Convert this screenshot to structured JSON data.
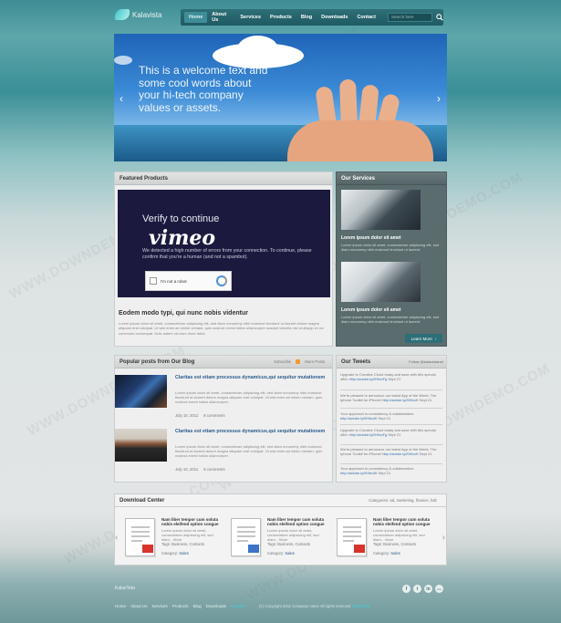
{
  "header": {
    "logo_text": "Kalavista",
    "nav": [
      {
        "label": "Home",
        "active": true
      },
      {
        "label": "About Us",
        "active": false
      },
      {
        "label": "Services",
        "active": false
      },
      {
        "label": "Products",
        "active": false
      },
      {
        "label": "Blog",
        "active": false
      },
      {
        "label": "Downloads",
        "active": false
      },
      {
        "label": "Contact",
        "active": false
      }
    ],
    "search_placeholder": "Search here"
  },
  "slider": {
    "text": "This is a welcome text and some cool words about your hi-tech company values or assets.",
    "prev": "‹",
    "next": "›"
  },
  "featured": {
    "heading": "Featured Products",
    "video_title": "Verify to continue",
    "video_brand": "vimeo",
    "video_message": "We detected a high number of errors from your connection. To continue, please confirm that you're a human (and not a spambot).",
    "captcha_label": "I'm not a robot",
    "post_title": "Eodem modo typi, qui nunc nobis videntur",
    "post_text": "Lorem ipsum dolor sit amet, consectetuer adipiscing elit, sed diam nonummy nibh euismod tincidunt ut laoreet dolore magna aliquam erat volutpat. Ut wisi enim ad minim veniam, quis nostrud exerci tation ullamcorper suscipit lobortis nisl ut aliquip ex ea commodo consequat. Duis autem vel eum iriure dolor."
  },
  "services": {
    "heading": "Our Services",
    "items": [
      {
        "title": "Lorem ipsum dolor sit amet",
        "text": "Lorem ipsum dolor sit amet, consectetuer adipiscing elit, sed diam nonummy nibh euismod tincidunt ut laoreet."
      },
      {
        "title": "Lorem ipsum dolor sit amet",
        "text": "Lorem ipsum dolor sit amet, consectetuer adipiscing elit, sed diam nonummy nibh euismod tincidunt ut laoreet."
      }
    ],
    "button": "Learn More"
  },
  "blog": {
    "heading": "Popular posts from Our Blog",
    "subscribe": "Subscribe",
    "more_posts": "More Posts",
    "posts": [
      {
        "title": "Claritas est etiam processus dynamicus,qui sequitur mutationem",
        "text": "Lorem ipsum dolor sit amet, consectetuer adipiscing elit, sed diam nonummy nibh euismod tincidunt ut laoreet dolore magna aliquam erat volutpat. Ut wisi enim ad minim veniam, quis nostrud exerci tation ullamcorper.",
        "date": "July 10, 2011",
        "comments": "8 comments"
      },
      {
        "title": "Claritas est etiam processus dynamicus,qui sequitur mutationem",
        "text": "Lorem ipsum dolor sit amet, consectetuer adipiscing elit, sed diam nonummy nibh euismod tincidunt ut laoreet dolore magna aliquam erat volutpat. Ut wisi enim ad minim veniam, quis nostrud exerci tation ullamcorper.",
        "date": "July 10, 2011",
        "comments": "8 comments"
      }
    ]
  },
  "tweets": {
    "heading": "Our Tweets",
    "follow": "Follow @kalavistanet",
    "items": [
      {
        "text": "Upgrade to Creative Cloud today and save with this special offer:",
        "link": "http://adobe.ly/i9XboFg",
        "time": "Sept 21"
      },
      {
        "text": "We're pleased to announce our latest App of the Week: The Iphone Toolkit for iPhone!",
        "link": "http://adobe.ly/i9XboH",
        "time": "Sept 21"
      },
      {
        "text": "Your approach to consistency & collaboration:",
        "link": "http://adobe.ly/i9XboW",
        "time": "Sept 21"
      },
      {
        "text": "Upgrade to Creative Cloud today and save with this special offer:",
        "link": "http://adobe.ly/i9XboFg",
        "time": "Sept 21"
      },
      {
        "text": "We're pleased to announce our latest App of the Week: The Iphone Toolkit for iPhone!",
        "link": "http://adobe.ly/i9XboH",
        "time": "Sept 21"
      },
      {
        "text": "Your approach to consistency & collaboration:",
        "link": "http://adobe.ly/i9XboW",
        "time": "Sept 21"
      }
    ]
  },
  "download": {
    "heading": "Download Center",
    "categories": "Categories: ad, marketing, finance, bdz",
    "items": [
      {
        "title": "Nam liber tempor cum soluta nobis eleifend option congue",
        "text": "Lorem ipsum dolor sit amet, consectetuer adipiscing elit, sed diam... More",
        "tags": "Tags: Business, Contacts",
        "category_label": "Category:",
        "category": "Sales"
      },
      {
        "title": "Nam liber tempor cum soluta nobis eleifend option congue",
        "text": "Lorem ipsum dolor sit amet, consectetuer adipiscing elit, sed diam... More",
        "tags": "Tags: Business, Contacts",
        "category_label": "Category:",
        "category": "Sales"
      },
      {
        "title": "Nam liber tempor cum soluta nobis eleifend option congue",
        "text": "Lorem ipsum dolor sit amet, consectetuer adipiscing elit, sed diam... More",
        "tags": "Tags: Business, Contacts",
        "category_label": "Category:",
        "category": "Sales"
      }
    ]
  },
  "footer": {
    "brand": "KalavTeta",
    "social": [
      "f",
      "t",
      "in",
      "rss"
    ],
    "nav": [
      "Home",
      "About Us",
      "Services",
      "Products",
      "Blog",
      "Downloads",
      "Contact"
    ],
    "copyright": "(C) Copyright 2011 Company name All rights reserved",
    "designed_by": "KalavVista"
  },
  "watermark": "WWW.DOWNDEMO.COM"
}
